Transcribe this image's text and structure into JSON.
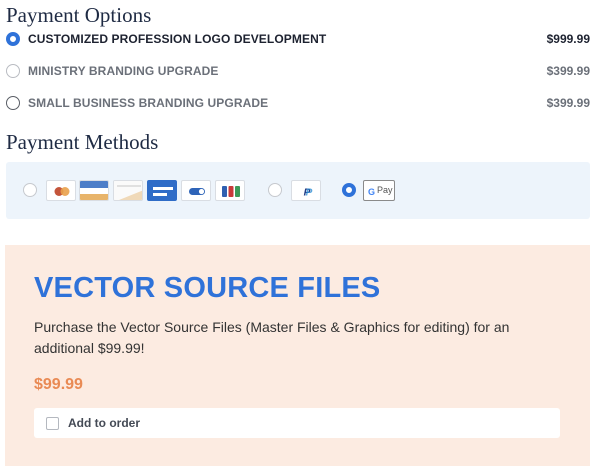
{
  "payment_options": {
    "title": "Payment Options",
    "items": [
      {
        "label": "CUSTOMIZED PROFESSION LOGO DEVELOPMENT",
        "price": "$999.99",
        "selected": true
      },
      {
        "label": "MINISTRY BRANDING UPGRADE",
        "price": "$399.99",
        "selected": false
      },
      {
        "label": "SMALL BUSINESS BRANDING UPGRADE",
        "price": "$399.99",
        "selected": false
      }
    ]
  },
  "payment_methods": {
    "title": "Payment Methods",
    "options": [
      {
        "name": "card",
        "icons": [
          "mastercard-icon",
          "card-blue-stripe-icon",
          "card-generic-icon",
          "amex-icon",
          "card-toggle-icon",
          "card-colored-bars-icon"
        ],
        "selected": false
      },
      {
        "name": "paypal",
        "icons": [
          "paypal-icon"
        ],
        "selected": false
      },
      {
        "name": "google-pay",
        "icons": [
          "google-pay-icon"
        ],
        "selected": true
      }
    ],
    "gpay_text": "Pay",
    "accent_color": "#2f72d9"
  },
  "upsell": {
    "title": "VECTOR SOURCE FILES",
    "description": "Purchase the Vector Source Files (Master Files & Graphics for editing) for an additional $99.99!",
    "price": "$99.99",
    "checkbox_label": "Add to order",
    "checked": false,
    "background_color": "#fcebe1",
    "title_color": "#2f72d9",
    "price_color": "#e98a54"
  }
}
